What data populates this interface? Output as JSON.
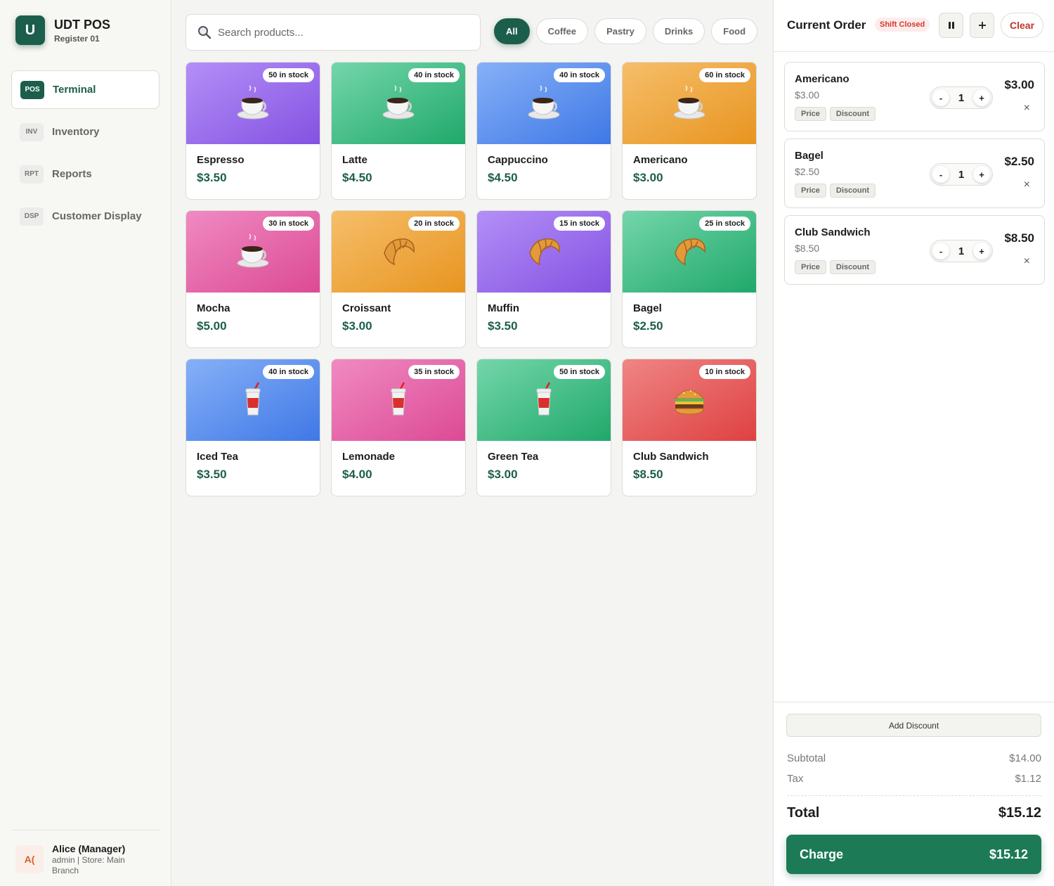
{
  "brand": {
    "logo_letter": "U",
    "title": "UDT POS",
    "subtitle": "Register 01",
    "accent": "#1c5e4c"
  },
  "nav": [
    {
      "badge": "POS",
      "label": "Terminal",
      "active": true
    },
    {
      "badge": "INV",
      "label": "Inventory",
      "active": false
    },
    {
      "badge": "RPT",
      "label": "Reports",
      "active": false
    },
    {
      "badge": "DSP",
      "label": "Customer Display",
      "active": false
    }
  ],
  "user": {
    "avatar": "A(",
    "name": "Alice (Manager)",
    "meta": "admin | Store: Main Branch"
  },
  "search": {
    "placeholder": "Search products..."
  },
  "filters": [
    {
      "label": "All",
      "active": true
    },
    {
      "label": "Coffee",
      "active": false
    },
    {
      "label": "Pastry",
      "active": false
    },
    {
      "label": "Drinks",
      "active": false
    },
    {
      "label": "Food",
      "active": false
    }
  ],
  "products": [
    {
      "name": "Espresso",
      "price": "$3.50",
      "stock": "50 in stock",
      "icon": "coffee-cup-icon",
      "color": "purple"
    },
    {
      "name": "Latte",
      "price": "$4.50",
      "stock": "40 in stock",
      "icon": "coffee-cup-icon",
      "color": "green"
    },
    {
      "name": "Cappuccino",
      "price": "$4.50",
      "stock": "40 in stock",
      "icon": "coffee-cup-icon",
      "color": "blue"
    },
    {
      "name": "Americano",
      "price": "$3.00",
      "stock": "60 in stock",
      "icon": "coffee-cup-icon",
      "color": "orange"
    },
    {
      "name": "Mocha",
      "price": "$5.00",
      "stock": "30 in stock",
      "icon": "coffee-cup-icon",
      "color": "pink"
    },
    {
      "name": "Croissant",
      "price": "$3.00",
      "stock": "20 in stock",
      "icon": "croissant-icon",
      "color": "orange"
    },
    {
      "name": "Muffin",
      "price": "$3.50",
      "stock": "15 in stock",
      "icon": "croissant-icon",
      "color": "purple"
    },
    {
      "name": "Bagel",
      "price": "$2.50",
      "stock": "25 in stock",
      "icon": "croissant-icon",
      "color": "green"
    },
    {
      "name": "Iced Tea",
      "price": "$3.50",
      "stock": "40 in stock",
      "icon": "cup-with-straw-icon",
      "color": "blue"
    },
    {
      "name": "Lemonade",
      "price": "$4.00",
      "stock": "35 in stock",
      "icon": "cup-with-straw-icon",
      "color": "pink"
    },
    {
      "name": "Green Tea",
      "price": "$3.00",
      "stock": "50 in stock",
      "icon": "cup-with-straw-icon",
      "color": "green"
    },
    {
      "name": "Club Sandwich",
      "price": "$8.50",
      "stock": "10 in stock",
      "icon": "burger-icon",
      "color": "red"
    }
  ],
  "order": {
    "title": "Current Order",
    "shift_status": "Shift Closed",
    "pause_icon": "pause-icon",
    "new_icon": "plus-icon",
    "clear_label": "Clear",
    "items": [
      {
        "name": "Americano",
        "unit_price": "$3.00",
        "qty": "1",
        "total": "$3.00",
        "price_tag": "Price",
        "discount_tag": "Discount"
      },
      {
        "name": "Bagel",
        "unit_price": "$2.50",
        "qty": "1",
        "total": "$2.50",
        "price_tag": "Price",
        "discount_tag": "Discount"
      },
      {
        "name": "Club Sandwich",
        "unit_price": "$8.50",
        "qty": "1",
        "total": "$8.50",
        "price_tag": "Price",
        "discount_tag": "Discount"
      }
    ],
    "minus_label": "-",
    "plus_label": "+",
    "remove_label": "×",
    "add_discount_label": "Add Discount",
    "subtotal_label": "Subtotal",
    "subtotal": "$14.00",
    "tax_label": "Tax",
    "tax": "$1.12",
    "total_label": "Total",
    "total": "$15.12",
    "charge_label": "Charge",
    "charge_amount": "$15.12",
    "charge_color": "#1c7a57",
    "shift_color": "#d13a30"
  }
}
